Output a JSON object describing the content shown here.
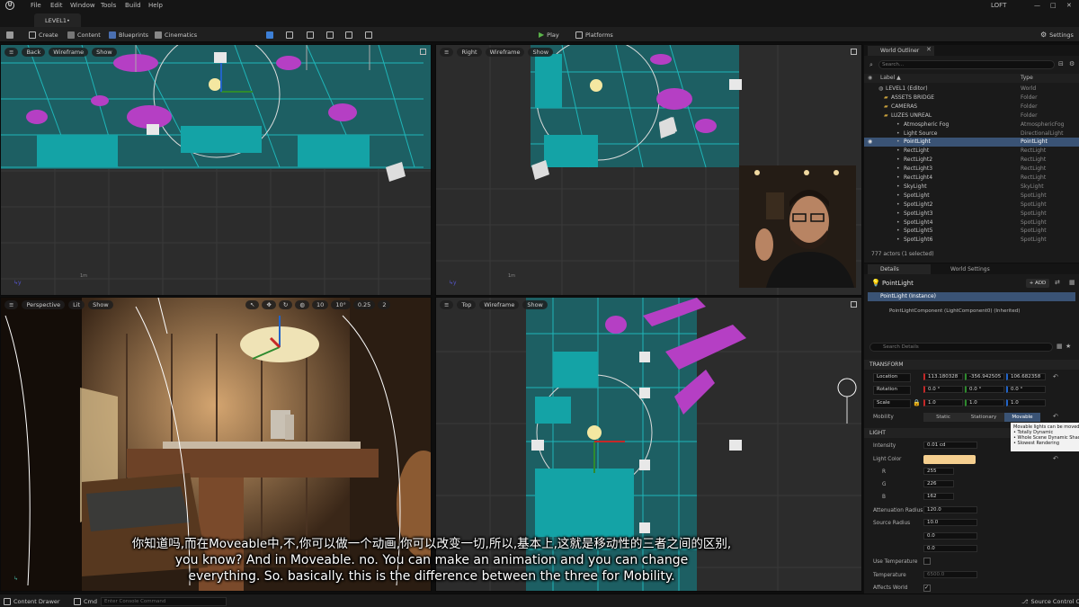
{
  "menu": {
    "items": [
      "File",
      "Edit",
      "Window",
      "Tools",
      "Build",
      "Help"
    ],
    "project": "LOFT"
  },
  "tab": {
    "label": "LEVEL1•"
  },
  "toolbar": {
    "create": "Create",
    "content": "Content",
    "blueprints": "Blueprints",
    "cinematics": "Cinematics",
    "play": "Play",
    "platforms": "Platforms",
    "settings": "Settings"
  },
  "viewports": {
    "back": {
      "view": "Back",
      "mode": "Wireframe",
      "show": "Show",
      "scale": "1m"
    },
    "right": {
      "view": "Right",
      "mode": "Wireframe",
      "show": "Show",
      "scale": "1m"
    },
    "perspective": {
      "view": "Perspective",
      "mode": "Lit",
      "show": "Show",
      "grid": "10",
      "angle": "10°",
      "scale_snap": "0.25",
      "cam_speed": "2"
    },
    "top": {
      "view": "Top",
      "mode": "Wireframe",
      "show": "Show"
    }
  },
  "outliner": {
    "tab": "World Outliner",
    "search_placeholder": "Search...",
    "col_label": "Label ▲",
    "col_type": "Type",
    "rows": [
      {
        "label": "LEVEL1 (Editor)",
        "type": "World"
      },
      {
        "label": "ASSETS BRIDGE",
        "type": "Folder"
      },
      {
        "label": "CAMERAS",
        "type": "Folder"
      },
      {
        "label": "LUZES UNREAL",
        "type": "Folder"
      },
      {
        "label": "Atmospheric Fog",
        "type": "AtmosphericFog"
      },
      {
        "label": "Light Source",
        "type": "DirectionalLight"
      },
      {
        "label": "PointLight",
        "type": "PointLight"
      },
      {
        "label": "RectLight",
        "type": "RectLight"
      },
      {
        "label": "RectLight2",
        "type": "RectLight"
      },
      {
        "label": "RectLight3",
        "type": "RectLight"
      },
      {
        "label": "RectLight4",
        "type": "RectLight"
      },
      {
        "label": "SkyLight",
        "type": "SkyLight"
      },
      {
        "label": "SpotLight",
        "type": "SpotLight"
      },
      {
        "label": "SpotLight2",
        "type": "SpotLight"
      },
      {
        "label": "SpotLight3",
        "type": "SpotLight"
      },
      {
        "label": "SpotLight4",
        "type": "SpotLight"
      },
      {
        "label": "SpotLight5",
        "type": "SpotLight"
      },
      {
        "label": "SpotLight6",
        "type": "SpotLight"
      }
    ],
    "footer": "777 actors (1 selected)"
  },
  "details": {
    "tab": "Details",
    "tab2": "World Settings",
    "actor": "PointLight",
    "add": "+ ADD",
    "instance": "PointLight (Instance)",
    "component": "PointLightComponent (LightComponent0) (Inherited)",
    "search_placeholder": "Search Details",
    "transform_header": "TRANSFORM",
    "location_label": "Location",
    "location": [
      "113.180328",
      "-356.942505",
      "106.682358"
    ],
    "rotation_label": "Rotation",
    "rotation": [
      "0.0 °",
      "0.0 °",
      "0.0 °"
    ],
    "scale_label": "Scale",
    "scale": [
      "1.0",
      "1.0",
      "1.0"
    ],
    "mobility_label": "Mobility",
    "mobility_options": [
      "Static",
      "Stationary",
      "Movable"
    ],
    "light_header": "LIGHT",
    "intensity_label": "Intensity",
    "intensity": "0.01 cd",
    "light_color_label": "Light Color",
    "light_color_hex": "#f5cf8f",
    "r_label": "R",
    "r": "255",
    "g_label": "G",
    "g": "226",
    "b_label": "B",
    "b": "162",
    "attenuation_label": "Attenuation Radius",
    "attenuation": "120.0",
    "source_radius_label": "Source Radius",
    "source_radius": "10.0",
    "extra1": "0.0",
    "extra2": "0.0",
    "use_temperature_label": "Use Temperature",
    "temperature_label": "Temperature",
    "temperature": "6500.0",
    "affects_world_label": "Affects World"
  },
  "tooltip": {
    "title": "Movable lights can be moved",
    "lines": [
      "• Totally Dynamic",
      "• Whole Scene Dynamic Shad",
      "• Slowest Rendering"
    ]
  },
  "statusbar": {
    "content_drawer": "Content Drawer",
    "cmd": "Cmd",
    "console_placeholder": "Enter Console Command",
    "source_control": "Source Control Off"
  },
  "subtitle": {
    "line1": "你知道吗,而在Moveable中,不,你可以做一个动画,你可以改变一切,所以,基本上,这就是移动性的三者之间的区别,",
    "line2": "you know? And in Moveable. no. You can make an animation and you can change",
    "line3": "everything. So. basically. this is the difference between the three for Mobility."
  },
  "colors": {
    "accent": "#3a5375",
    "wire_teal": "#18a0a6",
    "wire_magenta": "#b53fc4",
    "play_green": "#5bb54a"
  }
}
